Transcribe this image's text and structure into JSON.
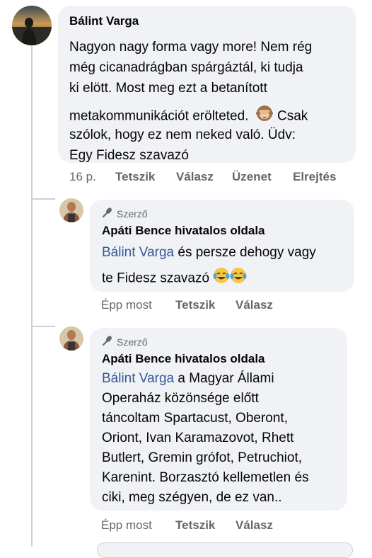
{
  "comment": {
    "author": "Bálint Varga",
    "lines": [
      "Nagyon nagy forma vagy more! Nem rég",
      "még cicanadrágban spárgáztál, ki tudja",
      "ki elött. Most meg ezt a betanított",
      "metakommunikációt erölteted.",
      " Csak",
      "szólok, hogy ez nem neked való. Üdv:",
      "Egy Fidesz szavazó"
    ],
    "emoji_icon": "see-no-evil-monkey-icon",
    "time": "16 p.",
    "actions": [
      "Tetszik",
      "Válasz",
      "Üzenet",
      "Elrejtés"
    ]
  },
  "replies": [
    {
      "badge": "Szerző",
      "author": "Apáti Bence hivatalos oldala",
      "mention": "Bálint Varga",
      "line1_rest": " és persze dehogy vagy",
      "line2": "te Fidesz szavazó ",
      "emoji_icon": "tears-of-joy-icon",
      "time": "Épp most",
      "actions": [
        "Tetszik",
        "Válasz"
      ]
    },
    {
      "badge": "Szerző",
      "author": "Apáti Bence hivatalos oldala",
      "mention": "Bálint Varga",
      "line1_rest": " a Magyar Állami",
      "lines": [
        "Operaház közönsége előtt",
        "táncoltam Spartacust, Oberont,",
        "Oriont, Ivan Karamazovot, Rhett",
        "Butlert, Gremin grófot, Petruchiot,",
        "Karenint. Borzasztó kellemetlen és",
        "ciki, meg szégyen, de ez van.."
      ],
      "time": "Épp most",
      "actions": [
        "Tetszik",
        "Válasz"
      ]
    }
  ]
}
